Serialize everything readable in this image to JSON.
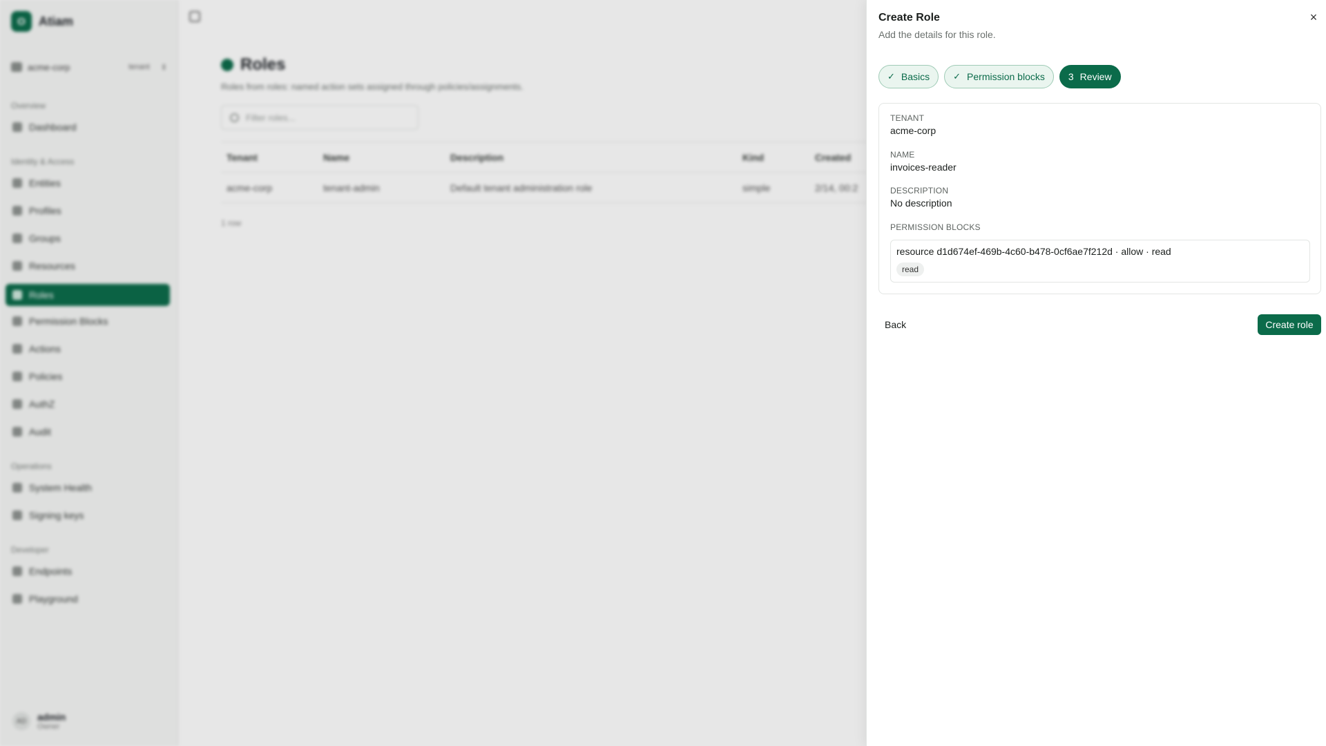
{
  "app": {
    "brand_logo": "O",
    "brand_name": "Atiam",
    "tenant_switcher": {
      "name": "acme-corp",
      "tag": "tenant"
    },
    "nav": {
      "group_overview": "Overview",
      "dashboard": "Dashboard",
      "group_identity": "Identity & Access",
      "entities": "Entities",
      "profiles": "Profiles",
      "groups": "Groups",
      "resources": "Resources",
      "roles": "Roles",
      "permission_blocks": "Permission Blocks",
      "actions": "Actions",
      "policies": "Policies",
      "authz": "AuthZ",
      "audit": "Audit",
      "group_operations": "Operations",
      "system_health": "System Health",
      "signing_keys": "Signing keys",
      "group_developer": "Developer",
      "endpoints": "Endpoints",
      "playground": "Playground"
    },
    "user": {
      "avatar": "AD",
      "name": "admin",
      "role": "Owner"
    },
    "page": {
      "title": "Roles",
      "subtitle": "Roles from roles: named action sets assigned through policies/assignments.",
      "filter_placeholder": "Filter roles..."
    },
    "table": {
      "headers": [
        "Tenant",
        "Name",
        "Description",
        "Kind",
        "Created"
      ],
      "rows": [
        [
          "acme-corp",
          "tenant-admin",
          "Default tenant administration role",
          "simple",
          "2/14, 00:2"
        ]
      ],
      "row_count": "1 row"
    }
  },
  "sheet": {
    "title": "Create Role",
    "description": "Add the details for this role.",
    "close_symbol": "×",
    "steps": [
      {
        "label": "Basics",
        "state": "done",
        "symbol": "✓"
      },
      {
        "label": "Permission blocks",
        "state": "done",
        "symbol": "✓"
      },
      {
        "label": "Review",
        "state": "current",
        "number": "3"
      }
    ],
    "review": {
      "tenant_label": "TENANT",
      "tenant_value": "acme-corp",
      "name_label": "NAME",
      "name_value": "invoices-reader",
      "description_label": "DESCRIPTION",
      "description_value": "No description",
      "permission_blocks_label": "PERMISSION BLOCKS",
      "permission_block": {
        "summary": "resource d1d674ef-469b-4c60-b478-0cf6ae7f212d · allow · read",
        "chip": "read"
      }
    },
    "back_label": "Back",
    "create_label": "Create role"
  },
  "colors": {
    "accent": "#0b6b4a",
    "accent_soft": "#eaf5ef",
    "overlay": "rgba(20,24,22,0.1)"
  }
}
